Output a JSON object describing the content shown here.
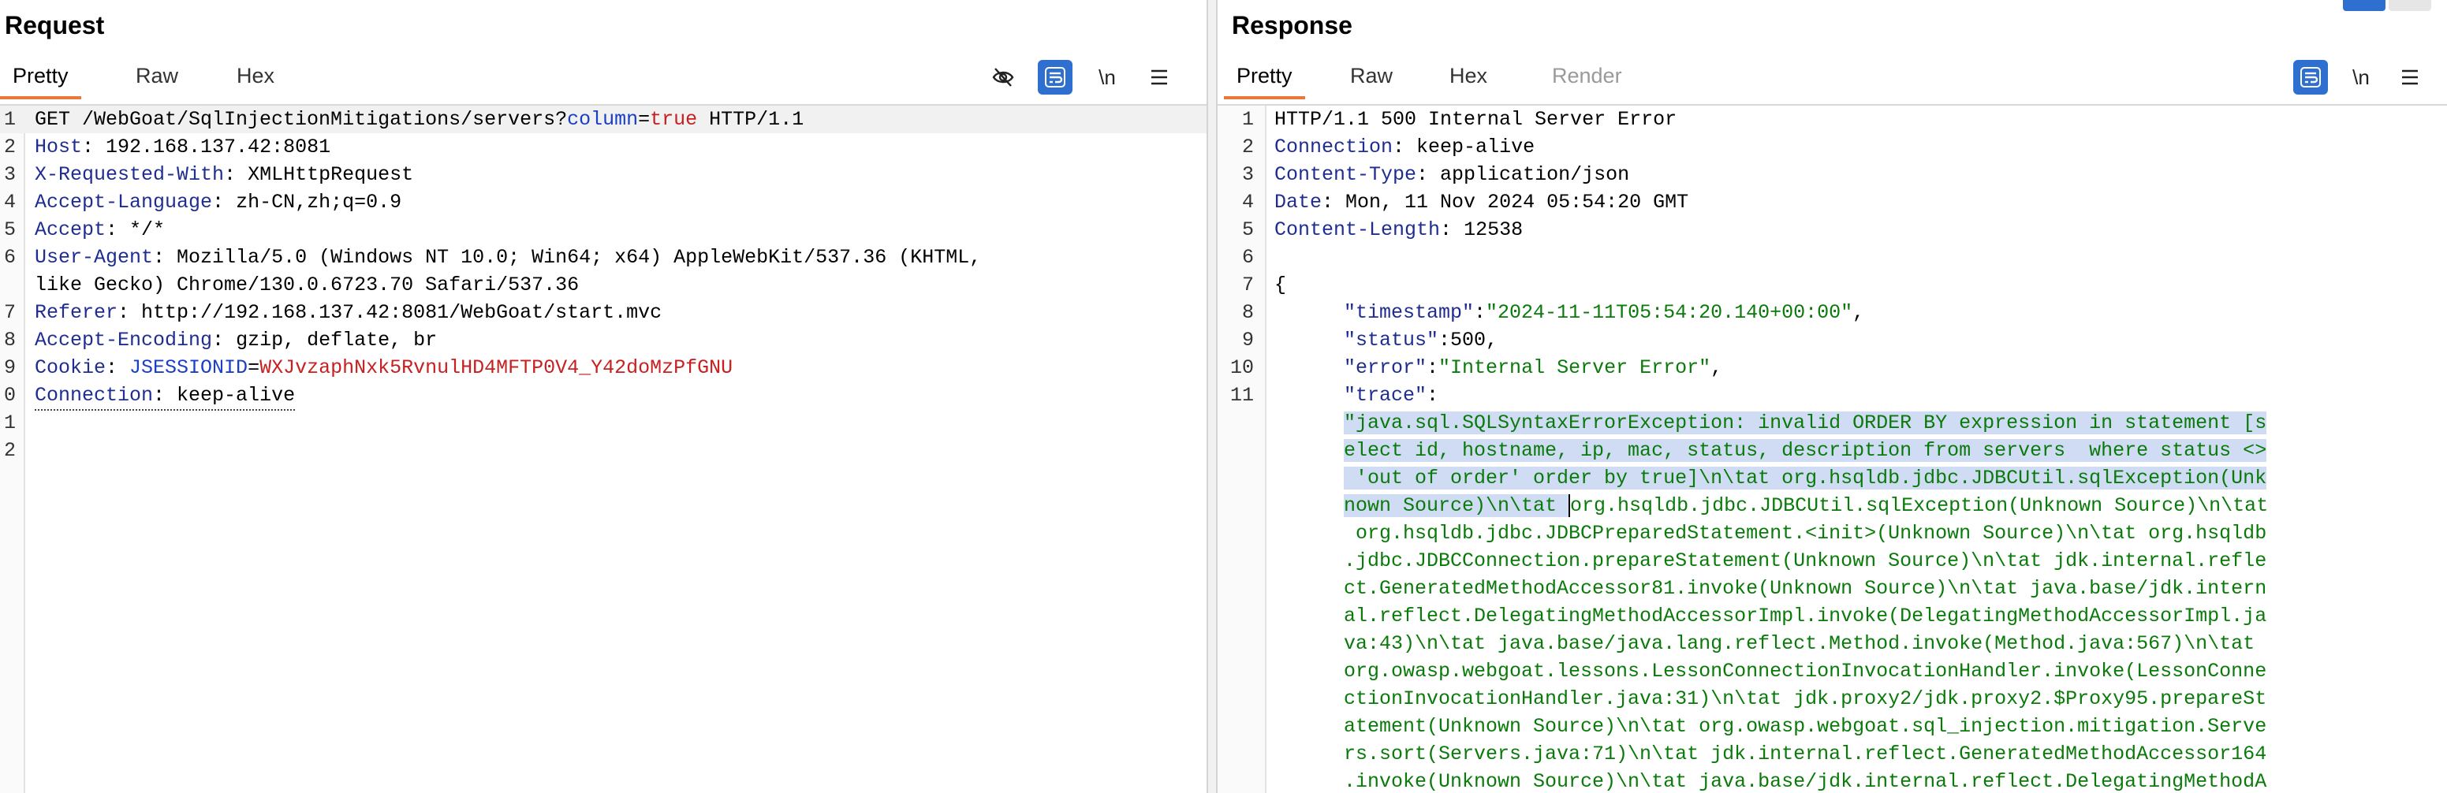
{
  "request": {
    "title": "Request",
    "tabs": [
      {
        "label": "Pretty",
        "active": true
      },
      {
        "label": "Raw",
        "active": false
      },
      {
        "label": "Hex",
        "active": false
      }
    ],
    "tools": {
      "newline_label": "\\n"
    },
    "lines": [
      {
        "num": "1",
        "method": "GET /WebGoat/SqlInjectionMitigations/servers?",
        "param": "column",
        "eq": "=",
        "value": "true",
        "tail": " HTTP/1.1"
      },
      {
        "num": "2",
        "name": "Host",
        "value": "192.168.137.42:8081"
      },
      {
        "num": "3",
        "name": "X-Requested-With",
        "value": "XMLHttpRequest"
      },
      {
        "num": "4",
        "name": "Accept-Language",
        "value": "zh-CN,zh;q=0.9"
      },
      {
        "num": "5",
        "name": "Accept",
        "value": "*/*"
      },
      {
        "num": "6",
        "name": "User-Agent",
        "value": "Mozilla/5.0 (Windows NT 10.0; Win64; x64) AppleWebKit/537.36 (KHTML,",
        "cont": "like Gecko) Chrome/130.0.6723.70 Safari/537.36"
      },
      {
        "num": "7",
        "name": "Referer",
        "value": "http://192.168.137.42:8081/WebGoat/start.mvc"
      },
      {
        "num": "8",
        "name": "Accept-Encoding",
        "value": "gzip, deflate, br"
      },
      {
        "num": "9",
        "name": "Cookie",
        "cookie_name": "JSESSIONID",
        "cookie_val": "WXJvzaphNxk5RvnulHD4MFTP0V4_Y42doMzPfGNU"
      },
      {
        "num": "0",
        "name": "Connection",
        "value": "keep-alive"
      },
      {
        "num": "1"
      },
      {
        "num": "2"
      }
    ]
  },
  "response": {
    "title": "Response",
    "tabs": [
      {
        "label": "Pretty",
        "active": true
      },
      {
        "label": "Raw",
        "active": false
      },
      {
        "label": "Hex",
        "active": false
      },
      {
        "label": "Render",
        "active": false
      }
    ],
    "tools": {
      "newline_label": "\\n"
    },
    "status_line": "HTTP/1.1 500 Internal Server Error",
    "headers": [
      {
        "num": "2",
        "name": "Connection",
        "value": "keep-alive"
      },
      {
        "num": "3",
        "name": "Content-Type",
        "value": "application/json"
      },
      {
        "num": "4",
        "name": "Date",
        "value": "Mon, 11 Nov 2024 05:54:20 GMT"
      },
      {
        "num": "5",
        "name": "Content-Length",
        "value": "12538"
      }
    ],
    "json_lines": [
      {
        "num": "7",
        "text": "{"
      },
      {
        "num": "8",
        "key": "\"timestamp\"",
        "val": "\"2024-11-11T05:54:20.140+00:00\"",
        "comma": ","
      },
      {
        "num": "9",
        "key": "\"status\"",
        "val": "500",
        "comma": ","
      },
      {
        "num": "10",
        "key": "\"error\"",
        "val": "\"Internal Server Error\"",
        "comma": ","
      },
      {
        "num": "11",
        "key": "\"trace\"",
        "val": "",
        "comma": ""
      }
    ],
    "trace_lines_selected": [
      "\"java.sql.SQLSyntaxErrorException: invalid ORDER BY expression in statement [s",
      "elect id, hostname, ip, mac, status, description from servers  where status <>",
      " 'out of order' order by true]\\n\\tat org.hsqldb.jdbc.JDBCUtil.sqlException(Unk",
      "nown Source)\\n\\tat "
    ],
    "trace_line4_rest": "org.hsqldb.jdbc.JDBCUtil.sqlException(Unknown Source)\\n\\tat",
    "trace_lines": [
      " org.hsqldb.jdbc.JDBCPreparedStatement.<init>(Unknown Source)\\n\\tat org.hsqldb",
      ".jdbc.JDBCConnection.prepareStatement(Unknown Source)\\n\\tat jdk.internal.refle",
      "ct.GeneratedMethodAccessor81.invoke(Unknown Source)\\n\\tat java.base/jdk.intern",
      "al.reflect.DelegatingMethodAccessorImpl.invoke(DelegatingMethodAccessorImpl.ja",
      "va:43)\\n\\tat java.base/java.lang.reflect.Method.invoke(Method.java:567)\\n\\tat",
      "org.owasp.webgoat.lessons.LessonConnectionInvocationHandler.invoke(LessonConne",
      "ctionInvocationHandler.java:31)\\n\\tat jdk.proxy2/jdk.proxy2.$Proxy95.prepareSt",
      "atement(Unknown Source)\\n\\tat org.owasp.webgoat.sql_injection.mitigation.Serve",
      "rs.sort(Servers.java:71)\\n\\tat jdk.internal.reflect.GeneratedMethodAccessor164",
      ".invoke(Unknown Source)\\n\\tat java.base/jdk.internal.reflect.DelegatingMethodA"
    ]
  },
  "colors": {
    "accent_tab": "#e8793b",
    "header_name": "#1f2d91",
    "json_string": "#0a7a0a",
    "selection": "#cfdcf4",
    "tool_blue": "#2e6fd0"
  }
}
